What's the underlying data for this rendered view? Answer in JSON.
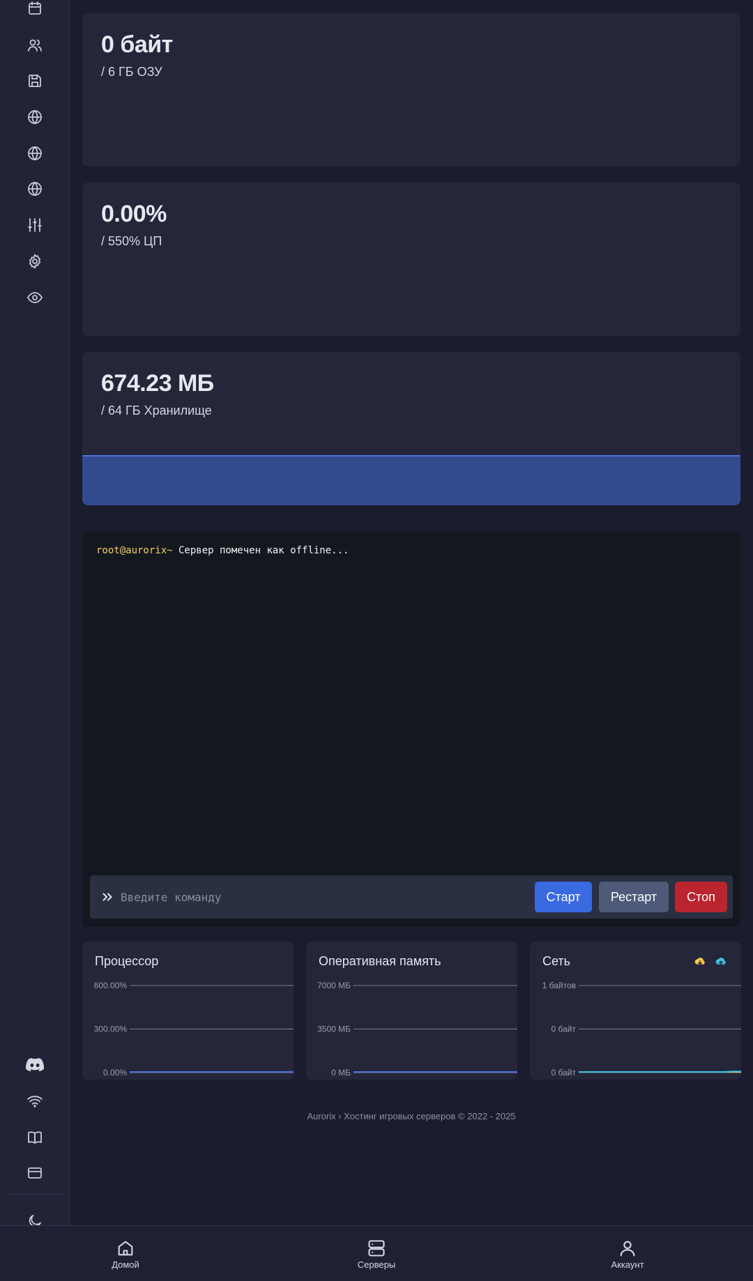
{
  "sidebar": {
    "top_icons": [
      "calendar-icon",
      "users-icon",
      "save-icon",
      "globe-icon",
      "globe-icon",
      "globe-icon",
      "sliders-icon",
      "gear-icon",
      "eye-icon"
    ],
    "bottom_icons": [
      "discord-icon",
      "wifi-icon",
      "book-icon",
      "credit-card-icon",
      "moon-icon"
    ]
  },
  "stats": {
    "ram": {
      "value": "0 байт",
      "limit": "/ 6 ГБ ОЗУ",
      "fraction": 0.0
    },
    "cpu": {
      "value": "0.00%",
      "limit": "/ 550% ЦП",
      "fraction": 0.0
    },
    "disk": {
      "value": "674.23 МБ",
      "limit": "/ 64 ГБ Хранилище",
      "fraction": 0.0103
    }
  },
  "console": {
    "prompt": "root@aurorix~",
    "message": " Сервер помечен как offline...",
    "input_placeholder": "Введите команду",
    "start_label": "Старт",
    "restart_label": "Рестарт",
    "stop_label": "Стоп"
  },
  "colors": {
    "accent": "#3a6ae0",
    "stop": "#bb2530",
    "restart": "#4e5a78",
    "prompt": "#f6cf63",
    "cpu_line": "#4a72d9",
    "net_up": "#f6c945",
    "net_down": "#3cc2e0"
  },
  "chart_data": [
    {
      "type": "line",
      "title": "Процессор",
      "yticks": [
        "600.00%",
        "300.00%",
        "0.00%"
      ],
      "ylim": [
        0,
        600
      ],
      "series": [
        {
          "values": [
            0,
            0,
            0,
            0,
            0,
            0,
            0,
            0,
            0,
            0,
            0,
            0,
            0,
            0,
            0,
            0,
            0,
            0,
            0,
            0.4
          ]
        }
      ]
    },
    {
      "type": "line",
      "title": "Оперативная память",
      "yticks": [
        "7000 МБ",
        "3500 МБ",
        "0 МБ"
      ],
      "ylim": [
        0,
        7000
      ],
      "series": [
        {
          "values": [
            0,
            0,
            0,
            0,
            0,
            0,
            0,
            0,
            0,
            0,
            0,
            0,
            0,
            0,
            0,
            0,
            0,
            0,
            0,
            0
          ]
        }
      ]
    },
    {
      "type": "line",
      "title": "Сеть",
      "yticks": [
        "1 байтов",
        "0 байт",
        "0 байт"
      ],
      "ylim": [
        0,
        1
      ],
      "series": [
        {
          "values": [
            0,
            0,
            0,
            0,
            0,
            0,
            0,
            0,
            0,
            0,
            0,
            0,
            0,
            0,
            0,
            0,
            0,
            0,
            0,
            0
          ]
        },
        {
          "values": [
            0,
            0,
            0,
            0,
            0,
            0,
            0,
            0,
            0,
            0,
            0,
            0,
            0,
            0,
            0,
            0,
            0,
            0,
            0.005,
            0.005
          ]
        }
      ]
    }
  ],
  "footer": {
    "text": "Aurorix › Хостинг игровых серверов © 2022 - 2025"
  },
  "bottom_nav": {
    "home": "Домой",
    "servers": "Серверы",
    "account": "Аккаунт"
  }
}
